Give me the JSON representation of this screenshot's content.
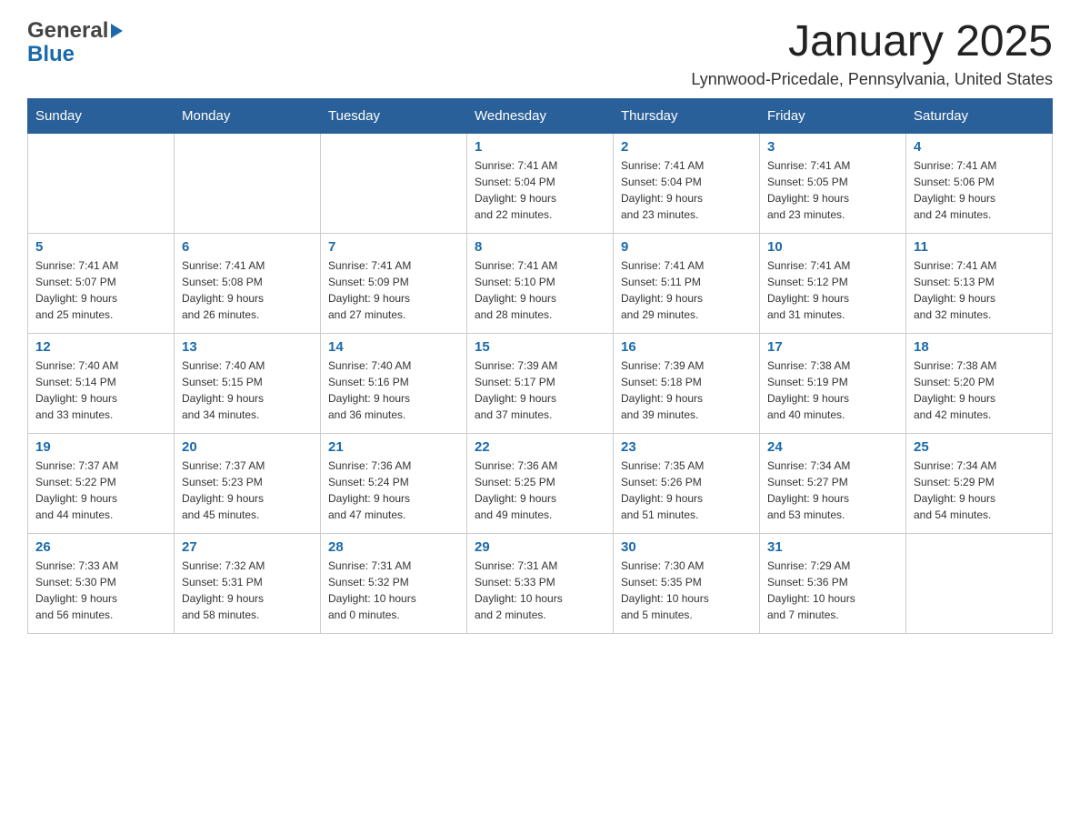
{
  "header": {
    "logo_general": "General",
    "logo_blue": "Blue",
    "title": "January 2025",
    "subtitle": "Lynnwood-Pricedale, Pennsylvania, United States"
  },
  "days_of_week": [
    "Sunday",
    "Monday",
    "Tuesday",
    "Wednesday",
    "Thursday",
    "Friday",
    "Saturday"
  ],
  "weeks": [
    [
      {
        "day": "",
        "info": ""
      },
      {
        "day": "",
        "info": ""
      },
      {
        "day": "",
        "info": ""
      },
      {
        "day": "1",
        "info": "Sunrise: 7:41 AM\nSunset: 5:04 PM\nDaylight: 9 hours\nand 22 minutes."
      },
      {
        "day": "2",
        "info": "Sunrise: 7:41 AM\nSunset: 5:04 PM\nDaylight: 9 hours\nand 23 minutes."
      },
      {
        "day": "3",
        "info": "Sunrise: 7:41 AM\nSunset: 5:05 PM\nDaylight: 9 hours\nand 23 minutes."
      },
      {
        "day": "4",
        "info": "Sunrise: 7:41 AM\nSunset: 5:06 PM\nDaylight: 9 hours\nand 24 minutes."
      }
    ],
    [
      {
        "day": "5",
        "info": "Sunrise: 7:41 AM\nSunset: 5:07 PM\nDaylight: 9 hours\nand 25 minutes."
      },
      {
        "day": "6",
        "info": "Sunrise: 7:41 AM\nSunset: 5:08 PM\nDaylight: 9 hours\nand 26 minutes."
      },
      {
        "day": "7",
        "info": "Sunrise: 7:41 AM\nSunset: 5:09 PM\nDaylight: 9 hours\nand 27 minutes."
      },
      {
        "day": "8",
        "info": "Sunrise: 7:41 AM\nSunset: 5:10 PM\nDaylight: 9 hours\nand 28 minutes."
      },
      {
        "day": "9",
        "info": "Sunrise: 7:41 AM\nSunset: 5:11 PM\nDaylight: 9 hours\nand 29 minutes."
      },
      {
        "day": "10",
        "info": "Sunrise: 7:41 AM\nSunset: 5:12 PM\nDaylight: 9 hours\nand 31 minutes."
      },
      {
        "day": "11",
        "info": "Sunrise: 7:41 AM\nSunset: 5:13 PM\nDaylight: 9 hours\nand 32 minutes."
      }
    ],
    [
      {
        "day": "12",
        "info": "Sunrise: 7:40 AM\nSunset: 5:14 PM\nDaylight: 9 hours\nand 33 minutes."
      },
      {
        "day": "13",
        "info": "Sunrise: 7:40 AM\nSunset: 5:15 PM\nDaylight: 9 hours\nand 34 minutes."
      },
      {
        "day": "14",
        "info": "Sunrise: 7:40 AM\nSunset: 5:16 PM\nDaylight: 9 hours\nand 36 minutes."
      },
      {
        "day": "15",
        "info": "Sunrise: 7:39 AM\nSunset: 5:17 PM\nDaylight: 9 hours\nand 37 minutes."
      },
      {
        "day": "16",
        "info": "Sunrise: 7:39 AM\nSunset: 5:18 PM\nDaylight: 9 hours\nand 39 minutes."
      },
      {
        "day": "17",
        "info": "Sunrise: 7:38 AM\nSunset: 5:19 PM\nDaylight: 9 hours\nand 40 minutes."
      },
      {
        "day": "18",
        "info": "Sunrise: 7:38 AM\nSunset: 5:20 PM\nDaylight: 9 hours\nand 42 minutes."
      }
    ],
    [
      {
        "day": "19",
        "info": "Sunrise: 7:37 AM\nSunset: 5:22 PM\nDaylight: 9 hours\nand 44 minutes."
      },
      {
        "day": "20",
        "info": "Sunrise: 7:37 AM\nSunset: 5:23 PM\nDaylight: 9 hours\nand 45 minutes."
      },
      {
        "day": "21",
        "info": "Sunrise: 7:36 AM\nSunset: 5:24 PM\nDaylight: 9 hours\nand 47 minutes."
      },
      {
        "day": "22",
        "info": "Sunrise: 7:36 AM\nSunset: 5:25 PM\nDaylight: 9 hours\nand 49 minutes."
      },
      {
        "day": "23",
        "info": "Sunrise: 7:35 AM\nSunset: 5:26 PM\nDaylight: 9 hours\nand 51 minutes."
      },
      {
        "day": "24",
        "info": "Sunrise: 7:34 AM\nSunset: 5:27 PM\nDaylight: 9 hours\nand 53 minutes."
      },
      {
        "day": "25",
        "info": "Sunrise: 7:34 AM\nSunset: 5:29 PM\nDaylight: 9 hours\nand 54 minutes."
      }
    ],
    [
      {
        "day": "26",
        "info": "Sunrise: 7:33 AM\nSunset: 5:30 PM\nDaylight: 9 hours\nand 56 minutes."
      },
      {
        "day": "27",
        "info": "Sunrise: 7:32 AM\nSunset: 5:31 PM\nDaylight: 9 hours\nand 58 minutes."
      },
      {
        "day": "28",
        "info": "Sunrise: 7:31 AM\nSunset: 5:32 PM\nDaylight: 10 hours\nand 0 minutes."
      },
      {
        "day": "29",
        "info": "Sunrise: 7:31 AM\nSunset: 5:33 PM\nDaylight: 10 hours\nand 2 minutes."
      },
      {
        "day": "30",
        "info": "Sunrise: 7:30 AM\nSunset: 5:35 PM\nDaylight: 10 hours\nand 5 minutes."
      },
      {
        "day": "31",
        "info": "Sunrise: 7:29 AM\nSunset: 5:36 PM\nDaylight: 10 hours\nand 7 minutes."
      },
      {
        "day": "",
        "info": ""
      }
    ]
  ]
}
